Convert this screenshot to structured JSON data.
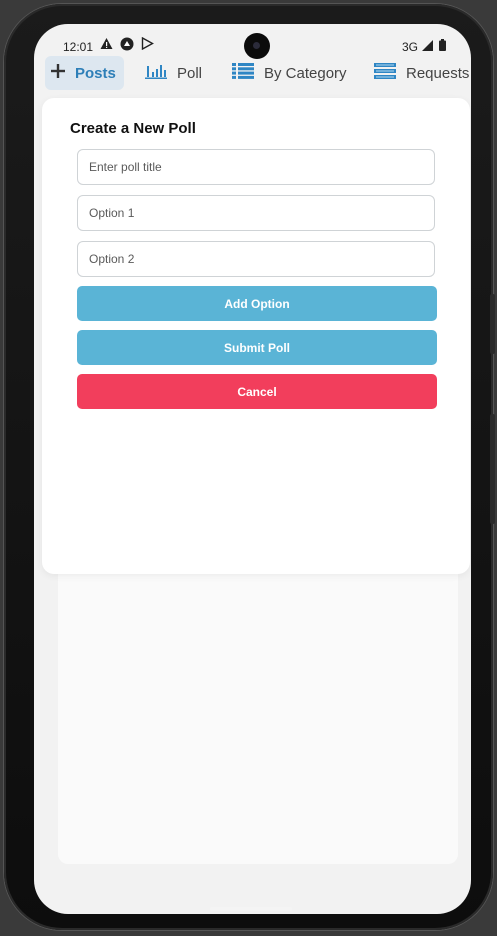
{
  "status_bar": {
    "time": "12:01",
    "network": "3G"
  },
  "tabs": [
    {
      "label": "Posts",
      "icon": "plus-icon",
      "active": true
    },
    {
      "label": "Poll",
      "icon": "bar-chart-icon",
      "active": false
    },
    {
      "label": "By Category",
      "icon": "list-icon",
      "active": false
    },
    {
      "label": "Requests",
      "icon": "stack-icon",
      "active": false
    }
  ],
  "modal": {
    "title": "Create a New Poll",
    "title_placeholder": "Enter poll title",
    "options": [
      {
        "placeholder": "Option 1"
      },
      {
        "placeholder": "Option 2"
      }
    ],
    "add_option_label": "Add Option",
    "submit_label": "Submit Poll",
    "cancel_label": "Cancel"
  },
  "colors": {
    "primary_button": "#5ab4d6",
    "cancel_button": "#f23e5c",
    "active_tab_text": "#2e7fb8",
    "active_tab_bg": "#dde7f0"
  }
}
